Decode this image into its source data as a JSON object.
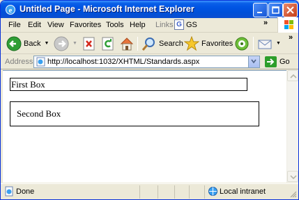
{
  "window": {
    "title": "Untitled Page - Microsoft Internet Explorer"
  },
  "menu": {
    "items": [
      "File",
      "Edit",
      "View",
      "Favorites",
      "Tools",
      "Help"
    ],
    "links_label": "Links",
    "gs_label": "GS",
    "gs_letter": "G"
  },
  "toolbar": {
    "back_label": "Back",
    "search_label": "Search",
    "favorites_label": "Favorites"
  },
  "address": {
    "label": "Address",
    "url": "http://localhost:1032/XHTML/Standards.aspx",
    "go_label": "Go"
  },
  "page": {
    "first_box": "First Box",
    "second_box": "Second Box"
  },
  "status": {
    "text": "Done",
    "zone": "Local intranet"
  },
  "colors": {
    "titlebar": "#0054e3",
    "chrome": "#ece9d8",
    "go_green": "#2d9e2b"
  }
}
